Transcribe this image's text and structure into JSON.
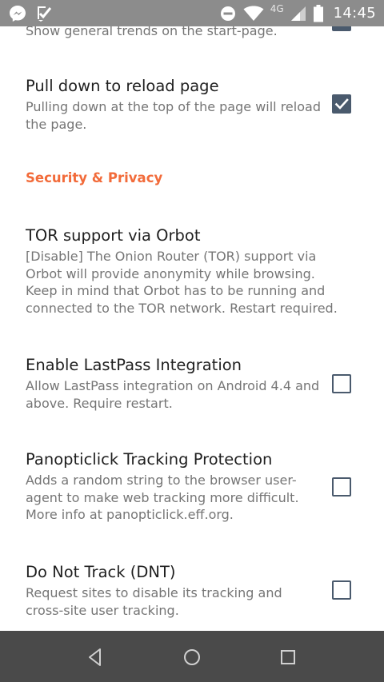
{
  "status_bar": {
    "network": "4G",
    "time": "14:45",
    "icons": [
      "messenger-icon",
      "check-app-icon",
      "do-not-disturb-icon",
      "wifi-icon",
      "cell-signal-icon",
      "battery-icon"
    ]
  },
  "settings": {
    "partial_item": {
      "summary": "Show general trends on the start-page.",
      "checked": true
    },
    "pull_down": {
      "title": "Pull down to reload page",
      "summary": "Pulling down at the top of the page will reload the page.",
      "checked": true
    },
    "section_security": {
      "header": "Security & Privacy"
    },
    "tor": {
      "title": "TOR support via Orbot",
      "summary": "[Disable] The Onion Router (TOR) support via Orbot will provide anonymity while browsing. Keep in mind that Orbot has to be running and connected to the TOR network. Restart required."
    },
    "lastpass": {
      "title": "Enable LastPass Integration",
      "summary": "Allow LastPass integration on Android 4.4 and above. Require restart.",
      "checked": false
    },
    "panopticlick": {
      "title": "Panopticlick Tracking Protection",
      "summary": "Adds a random string to the browser user-agent to make web tracking more difficult. More info at panopticlick.eff.org.",
      "checked": false
    },
    "dnt": {
      "title": "Do Not Track (DNT)",
      "summary": "Request sites to disable its tracking and cross-site user tracking.",
      "checked": false
    }
  },
  "colors": {
    "accent": "#f26b3a",
    "checkbox": "#4a5a6d",
    "status_bar": "#8c8c8c",
    "nav_bar": "#4a4a4a"
  },
  "nav_bar": {
    "buttons": [
      "back-icon",
      "home-icon",
      "recents-icon"
    ]
  }
}
